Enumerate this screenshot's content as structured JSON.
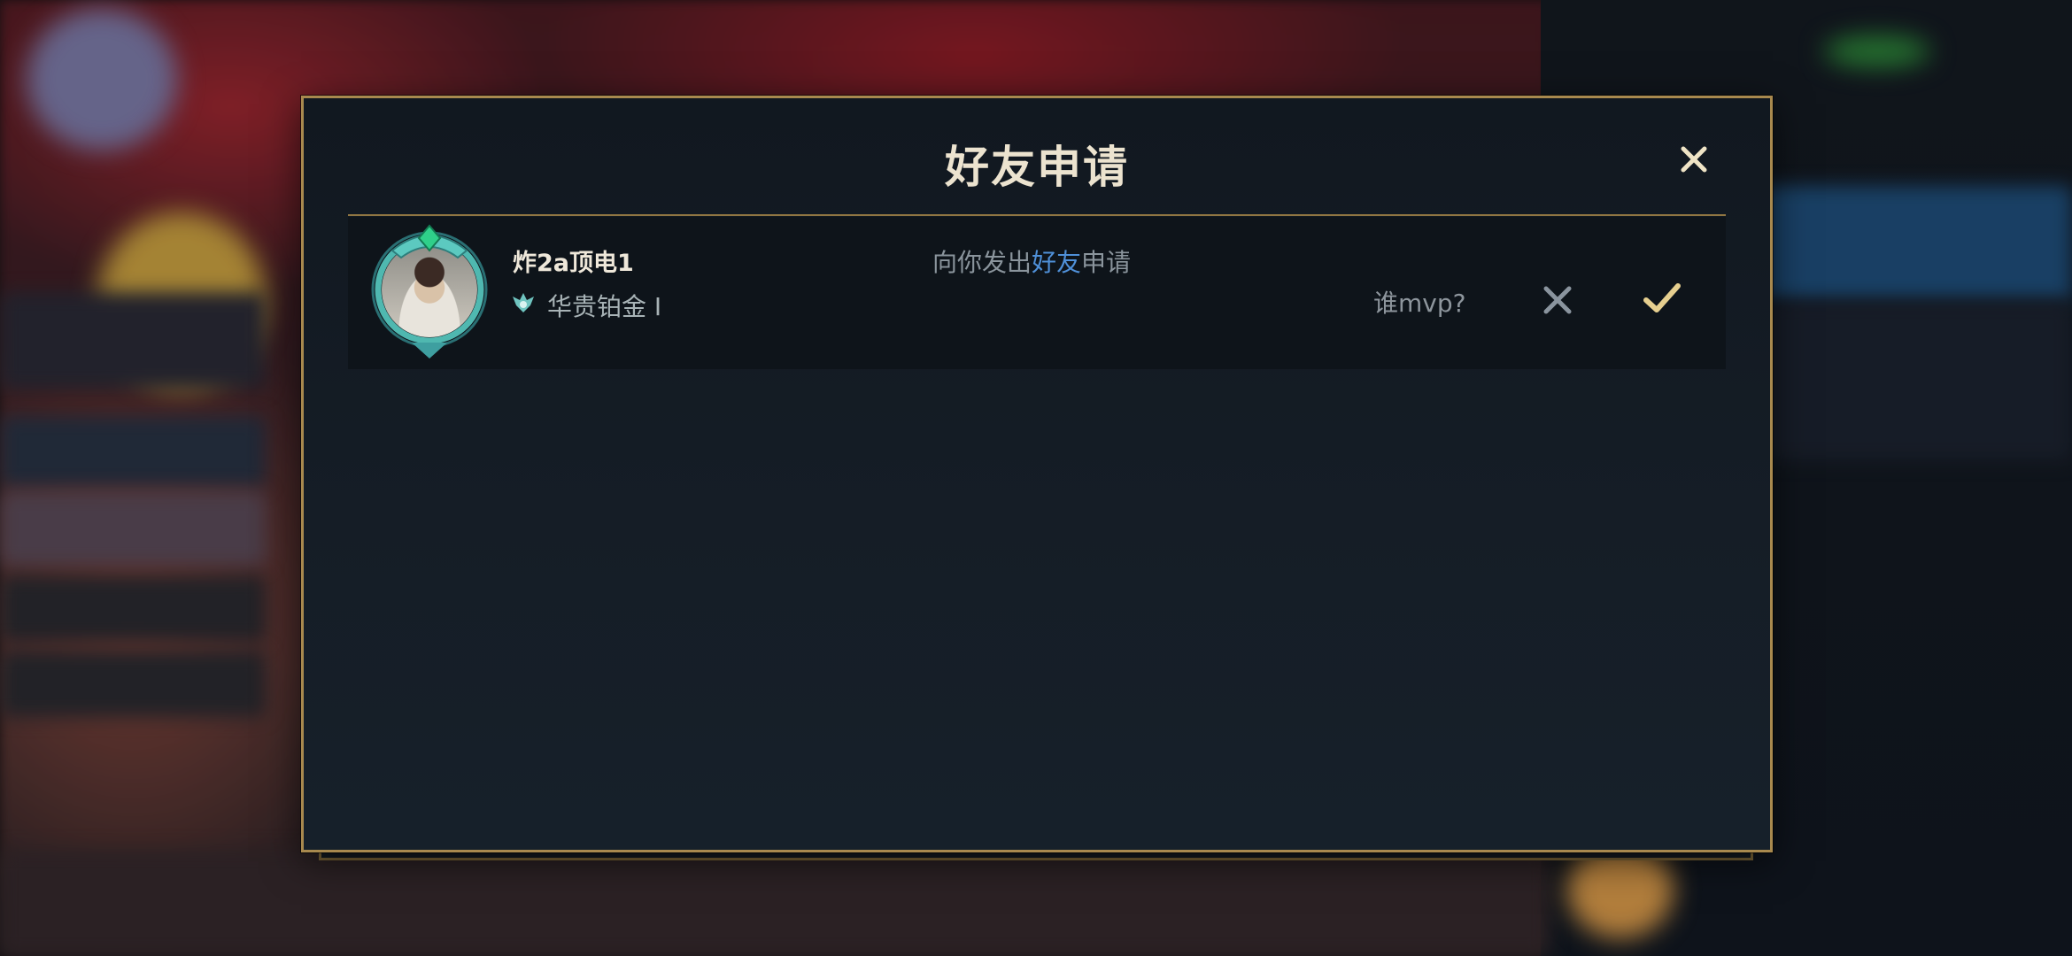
{
  "dialog": {
    "title": "好友申请",
    "close_icon": "close-icon"
  },
  "requests": [
    {
      "name": "炸2a顶电1",
      "rank": "华贵铂金 I",
      "message_prefix": "向你发出",
      "message_highlight": "好友",
      "message_suffix": "申请",
      "note": "谁mvp?",
      "reject_icon": "close-icon",
      "accept_icon": "check-icon"
    }
  ],
  "colors": {
    "gold_border": "#a8894e",
    "title": "#ece3cf",
    "highlight": "#4f90d8",
    "accept": "#e6cf8f",
    "reject": "#8a949e"
  }
}
